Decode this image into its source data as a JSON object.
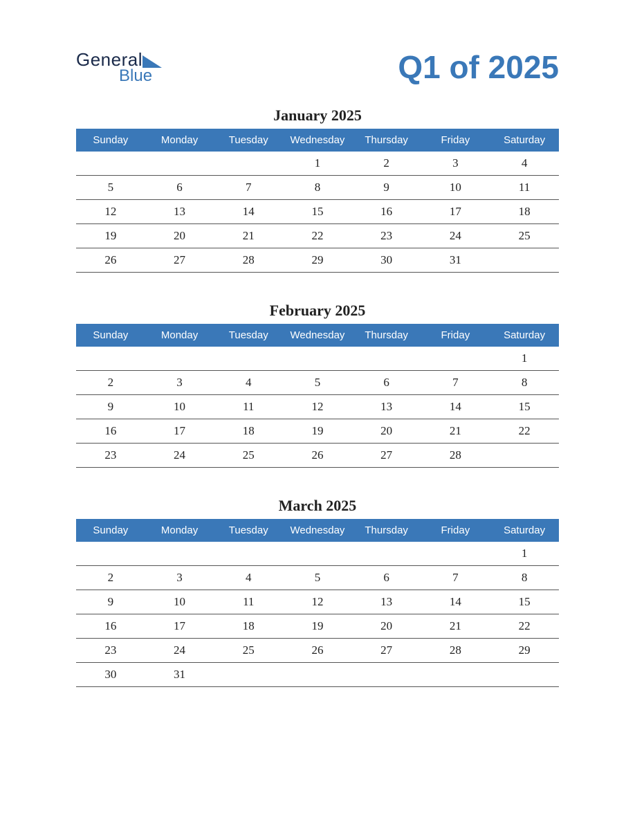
{
  "logo": {
    "word1": "General",
    "word2": "Blue"
  },
  "title": "Q1 of 2025",
  "dayHeaders": [
    "Sunday",
    "Monday",
    "Tuesday",
    "Wednesday",
    "Thursday",
    "Friday",
    "Saturday"
  ],
  "months": [
    {
      "title": "January 2025",
      "weeks": [
        [
          "",
          "",
          "",
          "1",
          "2",
          "3",
          "4"
        ],
        [
          "5",
          "6",
          "7",
          "8",
          "9",
          "10",
          "11"
        ],
        [
          "12",
          "13",
          "14",
          "15",
          "16",
          "17",
          "18"
        ],
        [
          "19",
          "20",
          "21",
          "22",
          "23",
          "24",
          "25"
        ],
        [
          "26",
          "27",
          "28",
          "29",
          "30",
          "31",
          ""
        ]
      ]
    },
    {
      "title": "February 2025",
      "weeks": [
        [
          "",
          "",
          "",
          "",
          "",
          "",
          "1"
        ],
        [
          "2",
          "3",
          "4",
          "5",
          "6",
          "7",
          "8"
        ],
        [
          "9",
          "10",
          "11",
          "12",
          "13",
          "14",
          "15"
        ],
        [
          "16",
          "17",
          "18",
          "19",
          "20",
          "21",
          "22"
        ],
        [
          "23",
          "24",
          "25",
          "26",
          "27",
          "28",
          ""
        ]
      ]
    },
    {
      "title": "March 2025",
      "weeks": [
        [
          "",
          "",
          "",
          "",
          "",
          "",
          "1"
        ],
        [
          "2",
          "3",
          "4",
          "5",
          "6",
          "7",
          "8"
        ],
        [
          "9",
          "10",
          "11",
          "12",
          "13",
          "14",
          "15"
        ],
        [
          "16",
          "17",
          "18",
          "19",
          "20",
          "21",
          "22"
        ],
        [
          "23",
          "24",
          "25",
          "26",
          "27",
          "28",
          "29"
        ],
        [
          "30",
          "31",
          "",
          "",
          "",
          "",
          ""
        ]
      ]
    }
  ]
}
